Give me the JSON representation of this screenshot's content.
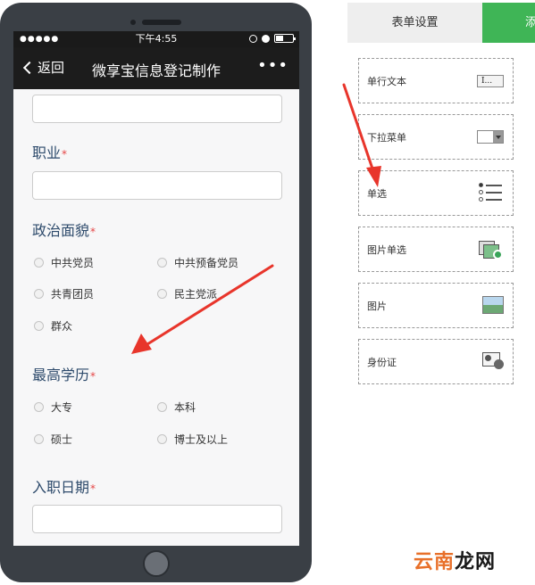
{
  "status_bar": {
    "signal": "●●●●●",
    "time": "下午4:55"
  },
  "nav": {
    "back_label": "返回",
    "title": "微享宝信息登记制作",
    "more": "•••"
  },
  "form": {
    "fields": [
      {
        "label": "职业",
        "required_mark": "*"
      },
      {
        "label": "政治面貌",
        "required_mark": "*",
        "options": [
          "中共党员",
          "中共预备党员",
          "共青团员",
          "民主党派",
          "群众"
        ]
      },
      {
        "label": "最高学历",
        "required_mark": "*",
        "options": [
          "大专",
          "本科",
          "硕士",
          "博士及以上"
        ]
      },
      {
        "label": "入职日期",
        "required_mark": "*"
      }
    ]
  },
  "panel": {
    "tabs": [
      "表单设置",
      "添加"
    ],
    "widgets": [
      {
        "label": "单行文本",
        "icon": "text-field-icon",
        "icon_text": "I..."
      },
      {
        "label": "下拉菜单",
        "icon": "dropdown-icon"
      },
      {
        "label": "单选",
        "icon": "radio-list-icon"
      },
      {
        "label": "图片单选",
        "icon": "image-radio-icon"
      },
      {
        "label": "图片",
        "icon": "image-icon"
      },
      {
        "label": "身份证",
        "icon": "id-card-icon"
      }
    ]
  },
  "watermark": {
    "part_a": "云南",
    "part_b": "龙网"
  },
  "colors": {
    "accent_green": "#3fb556",
    "arrow_red": "#e8352b",
    "label_blue": "#2d4a6b",
    "required_red": "#e54545"
  }
}
